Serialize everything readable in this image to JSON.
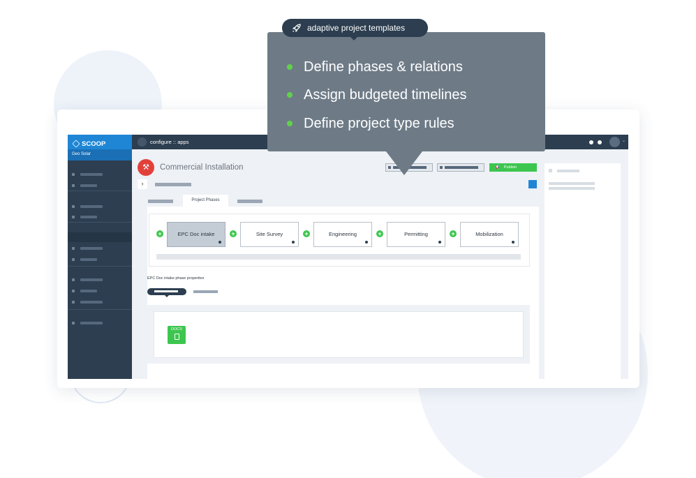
{
  "badge": {
    "label": "adaptive project templates",
    "icon": "rocket-icon"
  },
  "tooltip": {
    "items": [
      "Define phases & relations",
      "Assign budgeted timelines",
      "Define project type rules"
    ]
  },
  "app": {
    "brand": "SCOOP",
    "org": "Geo Solar",
    "breadcrumb": "configure :: apps",
    "project_title": "Commercial Installation",
    "publish_label": "Publish",
    "active_tab": "Project Phases",
    "phases": [
      "EPC Doc intake",
      "Site Survey",
      "Engineering",
      "Permitting",
      "Mobilization"
    ],
    "active_phase": "EPC Doc intake",
    "properties_label": "EPC Doc intake phase properties",
    "docs_label": "DOCS"
  },
  "colors": {
    "brand_blue": "#1f86d6",
    "navy": "#2c3e50",
    "accent_green": "#3dc64f",
    "bullet_green": "#5fd24a",
    "tooltip_gray": "#6e7b87",
    "project_red": "#e2413b"
  }
}
